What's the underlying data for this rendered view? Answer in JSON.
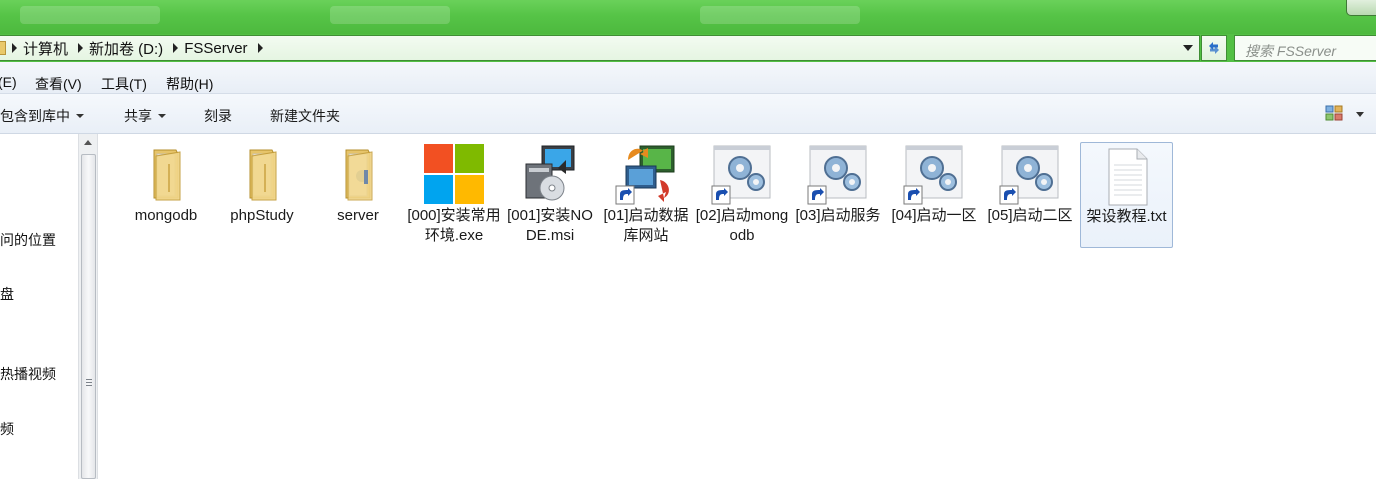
{
  "window": {
    "breadcrumb": [
      "计算机",
      "新加卷 (D:)",
      "FSServer"
    ],
    "search_placeholder": "搜索 FSServer"
  },
  "menu": [
    "(E)",
    "查看(V)",
    "工具(T)",
    "帮助(H)"
  ],
  "toolbar": {
    "include_in_library": "包含到库中",
    "share": "共享",
    "burn": "刻录",
    "new_folder": "新建文件夹"
  },
  "navpane": [
    "问的位置",
    "盘",
    "热播视频",
    "频"
  ],
  "files": [
    {
      "name": "mongodb",
      "icon": "folder-icon"
    },
    {
      "name": "phpStudy",
      "icon": "folder-icon"
    },
    {
      "name": "server",
      "icon": "folder-icon"
    },
    {
      "name": "[000]安装常用环境.exe",
      "icon": "windows-logo-icon"
    },
    {
      "name": "[001]安装NODE.msi",
      "icon": "installer-icon"
    },
    {
      "name": "[01]启动数据库网站",
      "icon": "network-shortcut-icon"
    },
    {
      "name": "[02]启动mongodb",
      "icon": "gear-shortcut-icon"
    },
    {
      "name": "[03]启动服务",
      "icon": "gear-shortcut-icon"
    },
    {
      "name": "[04]启动一区",
      "icon": "gear-shortcut-icon"
    },
    {
      "name": "[05]启动二区",
      "icon": "gear-shortcut-icon"
    },
    {
      "name": "架设教程.txt",
      "icon": "text-file-icon"
    }
  ]
}
